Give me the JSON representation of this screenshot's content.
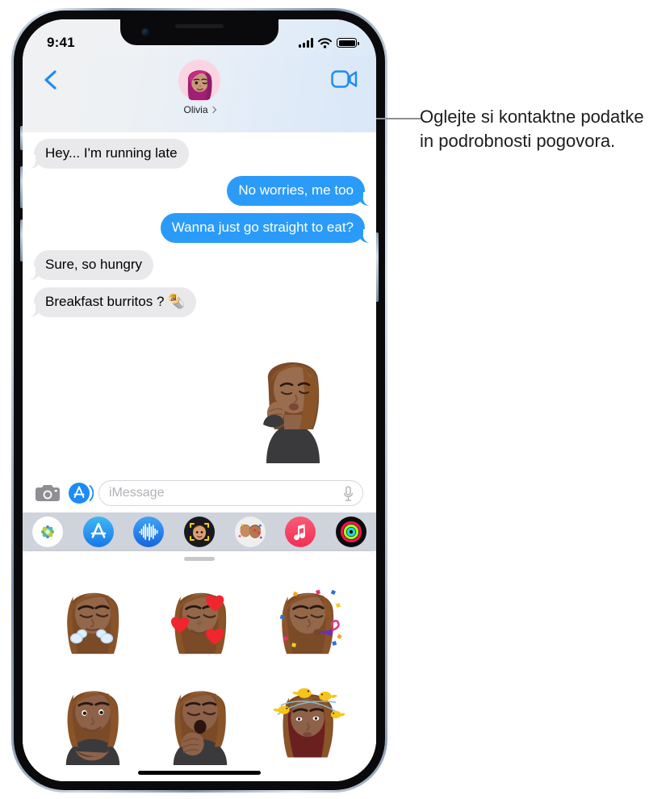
{
  "device": {
    "name": "iphone-12"
  },
  "status_bar": {
    "time": "9:41",
    "cellular_icon": "cellular-bars-icon",
    "wifi_icon": "wifi-icon",
    "battery_icon": "battery-icon"
  },
  "nav": {
    "back_icon": "chevron-left-icon",
    "facetime_icon": "video-camera-icon",
    "contact_name": "Olivia",
    "contact_chevron_icon": "chevron-right-icon",
    "avatar_icon": "memoji-avatar"
  },
  "messages": [
    {
      "id": 1,
      "side": "in",
      "text": "Hey... I'm running late"
    },
    {
      "id": 2,
      "side": "out",
      "text": "No worries, me too"
    },
    {
      "id": 3,
      "side": "out",
      "text": "Wanna just go straight to eat?"
    },
    {
      "id": 4,
      "side": "in",
      "text": "Sure, so hungry"
    },
    {
      "id": 5,
      "side": "in",
      "text": "Breakfast burritos ? 🌯"
    }
  ],
  "placed_sticker": {
    "name": "memoji-kiss-sticker"
  },
  "input_bar": {
    "camera_icon": "camera-icon",
    "appstore_icon": "app-store-icon",
    "placeholder": "iMessage",
    "mic_icon": "microphone-icon"
  },
  "app_drawer": {
    "items": [
      {
        "icon": "photos-icon",
        "label": "Photos",
        "selected": false
      },
      {
        "icon": "app-store-icon",
        "label": "App Store",
        "selected": false
      },
      {
        "icon": "audio-icon",
        "label": "Audio",
        "selected": false
      },
      {
        "icon": "memoji-icon",
        "label": "Memoji",
        "selected": false
      },
      {
        "icon": "stickers-icon",
        "label": "Stickers",
        "selected": true
      },
      {
        "icon": "music-icon",
        "label": "Music",
        "selected": false
      },
      {
        "icon": "fitness-icon",
        "label": "Fitness",
        "selected": false
      }
    ]
  },
  "sticker_sheet": {
    "grabber_icon": "drag-handle-icon",
    "stickers": [
      {
        "id": "s1",
        "name": "memoji-steam-nose-sticker"
      },
      {
        "id": "s2",
        "name": "memoji-hearts-sticker"
      },
      {
        "id": "s3",
        "name": "memoji-party-horn-sticker"
      },
      {
        "id": "s4",
        "name": "memoji-smiling-sticker"
      },
      {
        "id": "s5",
        "name": "memoji-yawn-sticker"
      },
      {
        "id": "s6",
        "name": "memoji-birds-sticker"
      }
    ]
  },
  "callout": {
    "text": "Oglejte si kontaktne podatke in podrobnosti pogovora."
  },
  "colors": {
    "outgoing_bubble": "#2b9bfa",
    "incoming_bubble": "#e9e9eb",
    "accent_blue": "#1b8cf5",
    "drawer_bg": "#cfd3dc"
  }
}
